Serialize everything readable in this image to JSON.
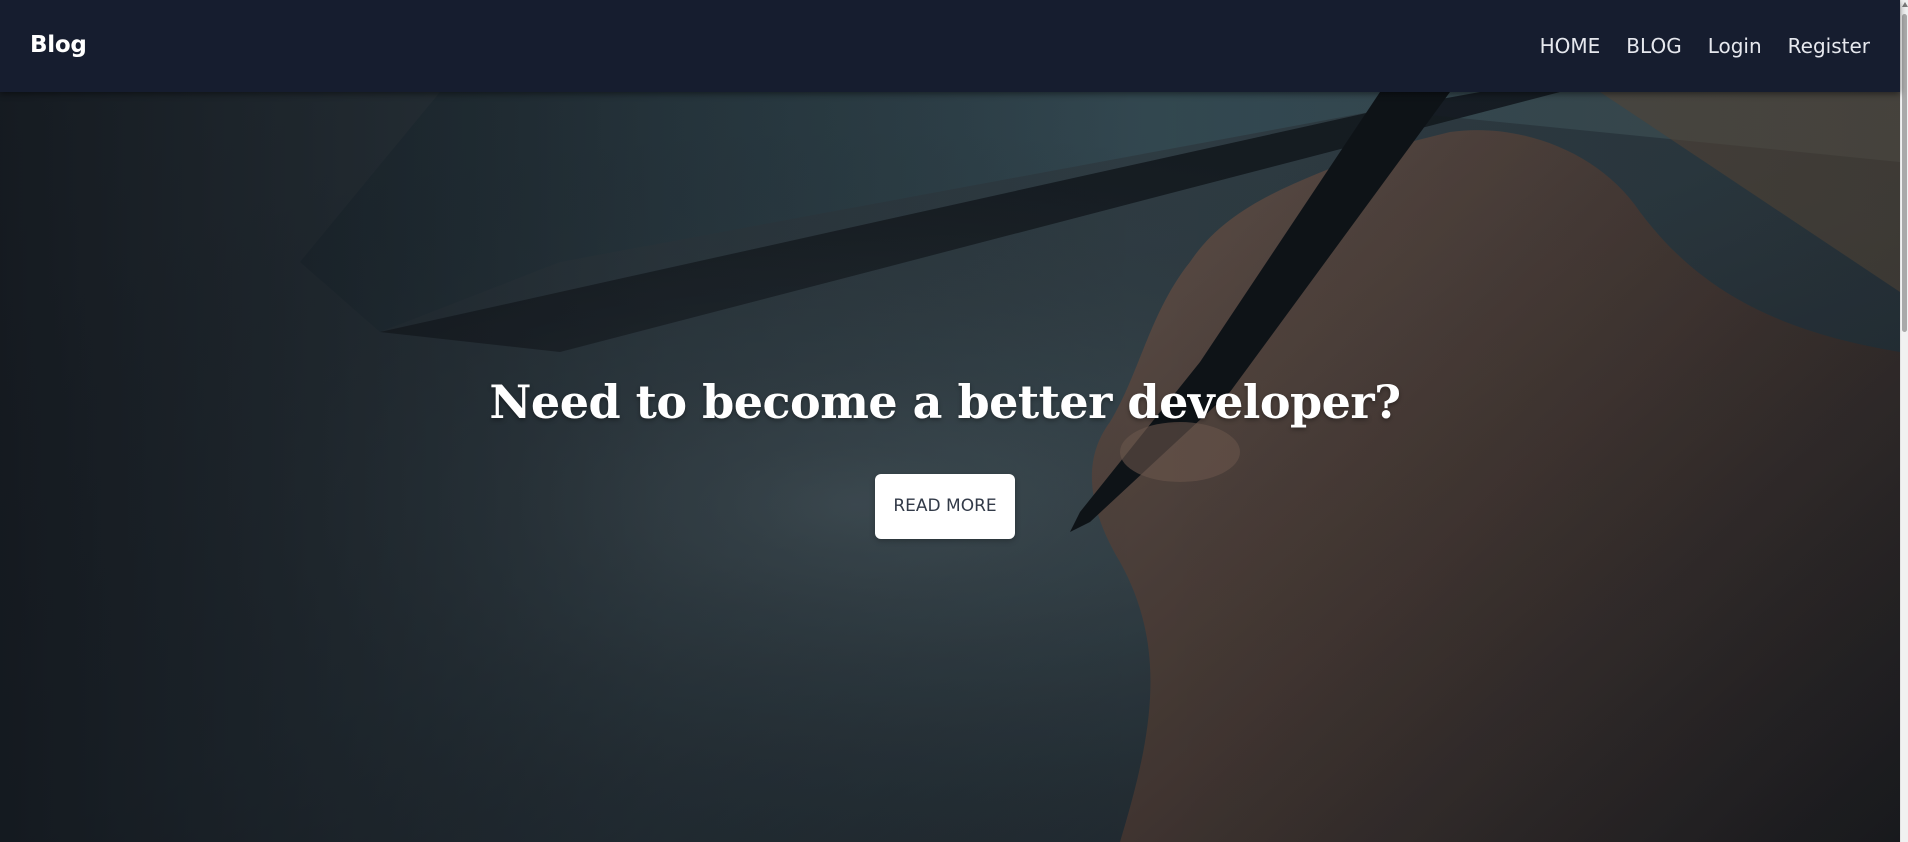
{
  "navbar": {
    "brand": "Blog",
    "links": [
      {
        "label": "HOME"
      },
      {
        "label": "BLOG"
      },
      {
        "label": "Login"
      },
      {
        "label": "Register"
      }
    ]
  },
  "hero": {
    "title": "Need to become a better developer?",
    "button_label": "READ MORE"
  },
  "colors": {
    "navbar_bg": "#161d2f",
    "hero_overlay": "#1e252e",
    "button_bg": "#ffffff",
    "button_text": "#323a48"
  }
}
